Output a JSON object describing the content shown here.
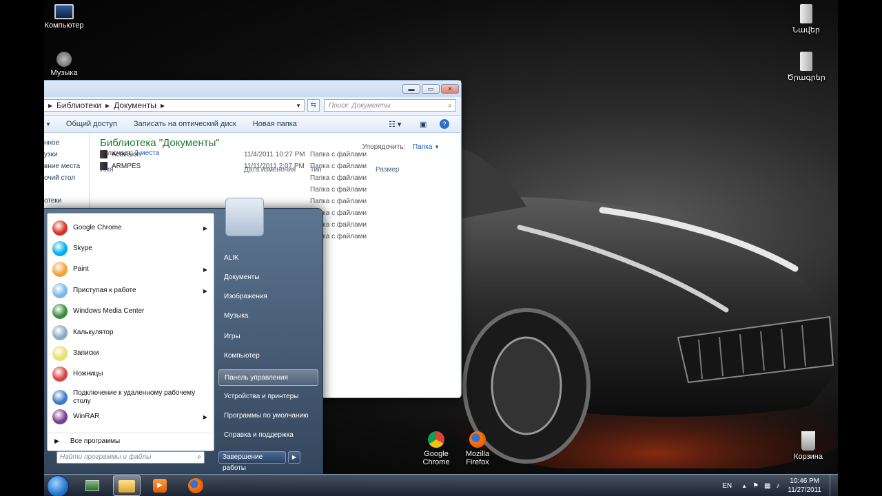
{
  "desktop": {
    "icons": [
      {
        "label": "Компьютер"
      },
      {
        "label": "Музыка"
      },
      {
        "label": "Նավեր"
      },
      {
        "label": "Ծրագրեր"
      },
      {
        "label": "Корзина"
      },
      {
        "label": "Google Chrome"
      },
      {
        "label": "Mozilla Firefox"
      }
    ]
  },
  "explorer": {
    "breadcrumb": [
      "Библиотеки",
      "Документы"
    ],
    "search_placeholder": "Поиск: Документы",
    "toolbar": [
      "Общий доступ",
      "Записать на оптический диск",
      "Новая папка"
    ],
    "nav_items": [
      "нное",
      "узки",
      "вние места",
      "очий стол",
      "отеки"
    ],
    "library_title": "Библиотека \"Документы\"",
    "includes_label": "Включает:",
    "includes_value": "2 места",
    "arrange_label": "Упорядочить:",
    "arrange_value": "Папка",
    "columns": {
      "name": "Имя",
      "date": "Дата изменения",
      "type": "Тип",
      "size": "Размер"
    },
    "rows": [
      {
        "name": "Activision",
        "date": "11/4/2011 10:27 PM",
        "type": "Папка с файлами"
      },
      {
        "name": "ARMPES",
        "date": "11/11/2011 2:07 PM",
        "type": "Папка с файлами"
      },
      {
        "type": "Папка с файлами"
      },
      {
        "type": "Папка с файлами"
      },
      {
        "type": "Папка с файлами"
      },
      {
        "type": "Папка с файлами"
      },
      {
        "type": "Папка с файлами"
      },
      {
        "type": "Папка с файлами"
      }
    ]
  },
  "startmenu": {
    "apps": [
      {
        "label": "Google Chrome",
        "has_arrow": true,
        "color": "#d93025"
      },
      {
        "label": "Skype",
        "has_arrow": false,
        "color": "#00aff0"
      },
      {
        "label": "Paint",
        "has_arrow": true,
        "color": "#f1a23a"
      },
      {
        "label": "Приступая к работе",
        "has_arrow": true,
        "color": "#7bb7e8"
      },
      {
        "label": "Windows Media Center",
        "has_arrow": false,
        "color": "#3a8d3e"
      },
      {
        "label": "Калькулятор",
        "has_arrow": false,
        "color": "#8aa8c6"
      },
      {
        "label": "Записки",
        "has_arrow": false,
        "color": "#e8e06b"
      },
      {
        "label": "Ножницы",
        "has_arrow": false,
        "color": "#d84343"
      },
      {
        "label": "Подключение к удаленному рабочему столу",
        "has_arrow": false,
        "color": "#3b7bc8"
      },
      {
        "label": "WinRAR",
        "has_arrow": true,
        "color": "#7a3d8f"
      }
    ],
    "all_programs": "Все программы",
    "search_placeholder": "Найти программы и файлы",
    "right_items": [
      "ALIK",
      "Документы",
      "Изображения",
      "Музыка",
      "Игры",
      "Компьютер",
      "Панель управления",
      "Устройства и принтеры",
      "Программы по умолчанию",
      "Справка и поддержка"
    ],
    "selected_right": "Панель управления",
    "shutdown_label": "Завершение работы"
  },
  "taskbar": {
    "lang": "EN",
    "time": "10:46 PM",
    "date": "11/27/2011"
  }
}
